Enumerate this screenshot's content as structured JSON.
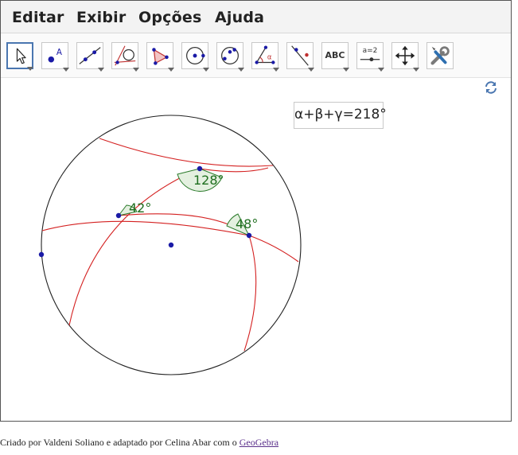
{
  "menu": {
    "items": [
      "Editar",
      "Exibir",
      "Opções",
      "Ajuda"
    ]
  },
  "toolbar": {
    "tools": [
      "move-tool",
      "point-tool",
      "line-tool",
      "tangent-tool",
      "polygon-tool",
      "circle-center-tool",
      "circle-three-points-tool",
      "angle-tool",
      "reflect-tool",
      "text-tool",
      "slider-tool",
      "move-graphics-view-tool",
      "settings-tool"
    ],
    "text_tool_label": "ABC",
    "slider_tool_label": "a=2"
  },
  "graphics": {
    "angle_sum_formula": "α+β+γ=218°",
    "angles": [
      {
        "label": "128°",
        "value": 128
      },
      {
        "label": "42°",
        "value": 42
      },
      {
        "label": "48°",
        "value": 48
      }
    ],
    "circle_color": "#222222",
    "arc_color": "#d42020",
    "point_color": "#1a1aa6",
    "angle_fill_color": "#e4f0e0",
    "angle_label_color": "#1e6e1e"
  },
  "footer": {
    "text": "Criado por Valdeni Soliano e adaptado por Celina Abar com o",
    "link_label": "GeoGebra"
  }
}
